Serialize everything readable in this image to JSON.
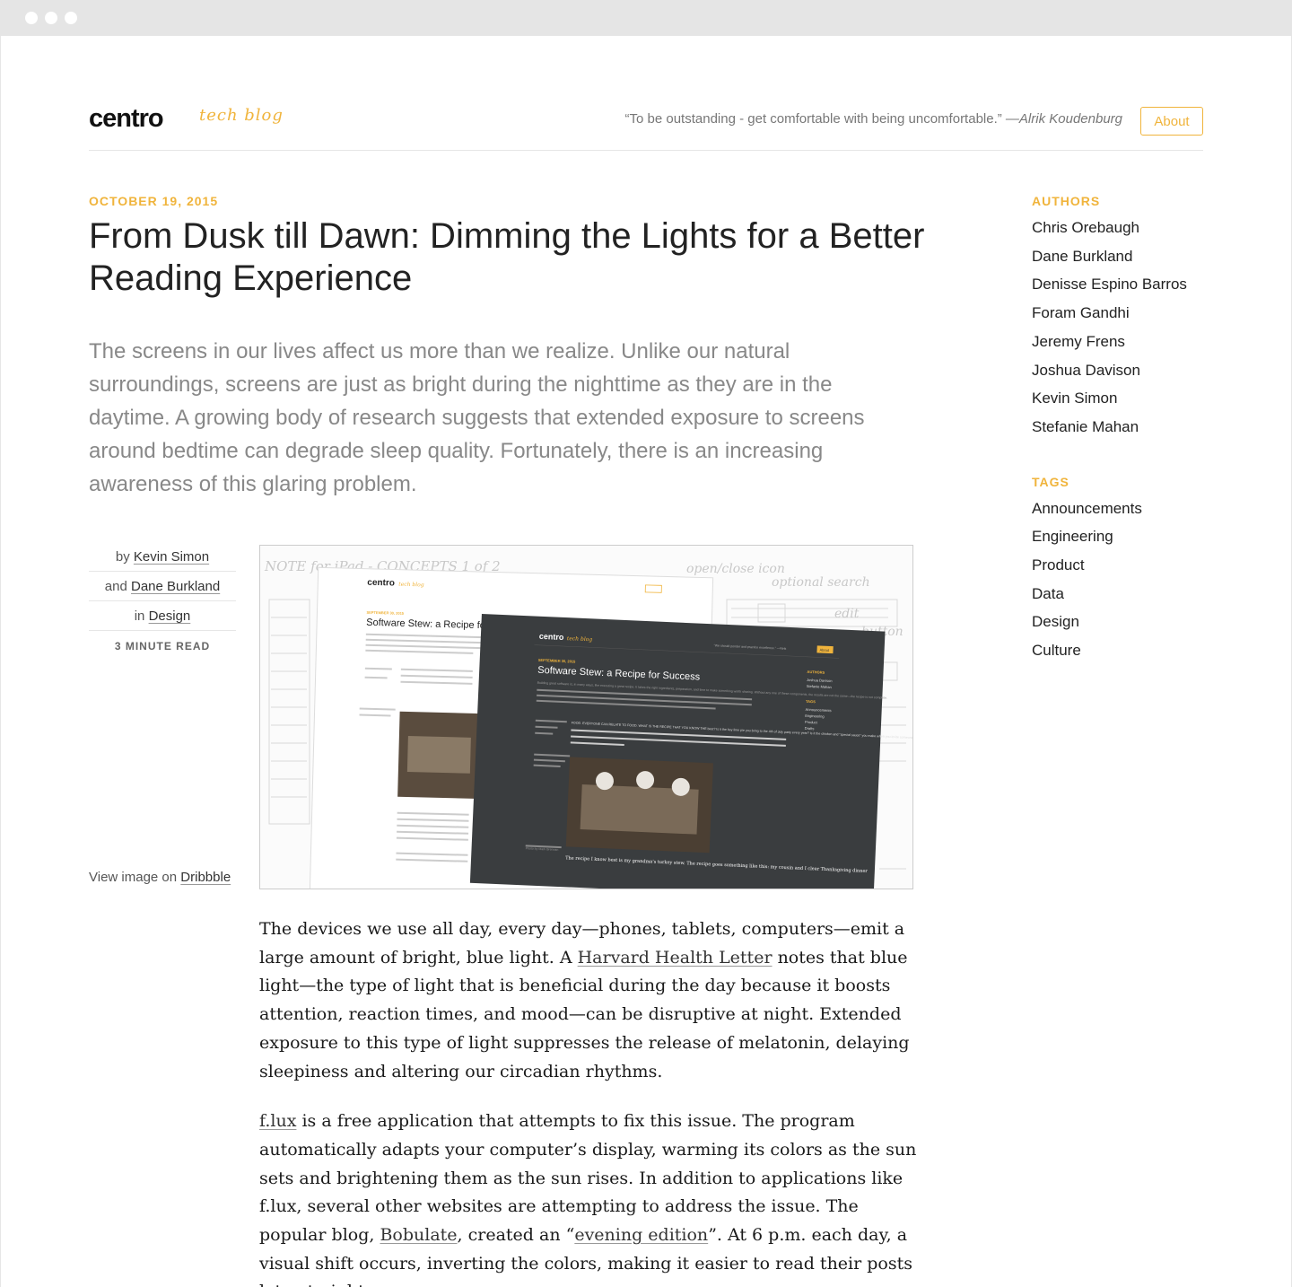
{
  "header": {
    "logo": "centro",
    "logo_sub": "tech blog",
    "quote": "“To be outstanding - get comfortable with being uncomfortable.”",
    "quote_author": "—Alrik Koudenburg",
    "about_label": "About"
  },
  "article": {
    "date": "OCTOBER 19, 2015",
    "title": "From Dusk till Dawn: Dimming the Lights for a Better Reading Experience",
    "lede": "The screens in our lives affect us more than we realize. Unlike our natural surroundings, screens are just as bright during the nighttime as they are in the daytime. A growing body of research suggests that extended exposure to screens around bedtime can degrade sleep quality. Fortunately, there is an increasing awareness of this glaring problem.",
    "meta": {
      "by_prefix": "by",
      "author1": "Kevin Simon",
      "and_prefix": "and",
      "author2": "Dane Burkland",
      "in_prefix": "in",
      "category": "Design",
      "read_time": "3 MINUTE READ"
    },
    "caption_prefix": "View image on",
    "caption_link": "Dribbble",
    "figure": {
      "sketch_text": "NOTE for iPad - CONCEPTS  1 of 2",
      "sketch_note1": "open/close icon",
      "sketch_note2": "optional search",
      "sketch_note3": "edit",
      "sketch_note4": "button",
      "light_logo": "centro",
      "light_logo_sub": "tech blog",
      "light_date": "SEPTEMBER 30, 2015",
      "light_title": "Software Stew: a Recipe for Success",
      "dark_logo": "centro",
      "dark_logo_sub": "tech blog",
      "dark_quote": "“We should ponder and practice excellence.” —Nels",
      "dark_about": "About",
      "dark_date": "SEPTEMBER 30, 2015",
      "dark_title": "Software Stew: a Recipe for Success",
      "dark_lede": "Building great software is, in many ways, like executing a great recipe. It takes the right ingredients, preparation, and time to make something worth sharing. Without any one of these components, the results are not the same—the recipe is not complete.",
      "dark_food": "FOOD. EVERYONE CAN RELATE TO FOOD. WHAT IS THE RECIPE THAT YOU KNOW THE best? Is it the key lime pie you bring to the 4th of July party every year? Is it the chicken and “special sauce” you make when you invite someone close to dinner?",
      "dark_body": "The recipe I know best is my grandma's turkey stew. The recipe goes something like this: my cousin and I clear Thanksgiving dinner",
      "dark_authors_head": "AUTHORS",
      "dark_authors": [
        "Joshua Davison",
        "Stefanie Mahan"
      ],
      "dark_tags_head": "TAGS",
      "dark_tags": [
        "Announcements",
        "Engineering",
        "Product",
        "Drafts"
      ],
      "photo_credit": "Photo by Mark Brennan"
    },
    "paragraph1": {
      "t1": "The devices we use all day, every day—phones, tablets, computers—emit a large amount of bright, blue light. A ",
      "link": "Harvard Health Letter",
      "t2": " notes that blue light—the type of light that is beneficial during the day because it boosts attention, reaction times, and mood—can be disruptive at night. Extended exposure to this type of light suppresses the release of melatonin, delaying sleepiness and altering our circadian rhythms."
    },
    "paragraph2": {
      "link1": "f.lux",
      "t1": " is a free application that attempts to fix this issue. The program automatically adapts your computer’s display, warming its colors as the sun sets and brightening them as the sun rises. In addition to applications like f.lux, several other websites are attempting to address the issue. The popular blog, ",
      "link2": "Bobulate",
      "t2": ", created an “",
      "link3": "evening edition",
      "t3": "”. At 6 p.m. each day, a visual shift occurs, inverting the colors, making it easier to read their posts late at night."
    }
  },
  "sidebar": {
    "authors_heading": "AUTHORS",
    "authors": [
      "Chris Orebaugh",
      "Dane Burkland",
      "Denisse Espino Barros",
      "Foram Gandhi",
      "Jeremy Frens",
      "Joshua Davison",
      "Kevin Simon",
      "Stefanie Mahan"
    ],
    "tags_heading": "TAGS",
    "tags": [
      "Announcements",
      "Engineering",
      "Product",
      "Data",
      "Design",
      "Culture"
    ]
  },
  "colors": {
    "accent": "#f0b43c",
    "dark_panel": "#3a3d3f"
  }
}
